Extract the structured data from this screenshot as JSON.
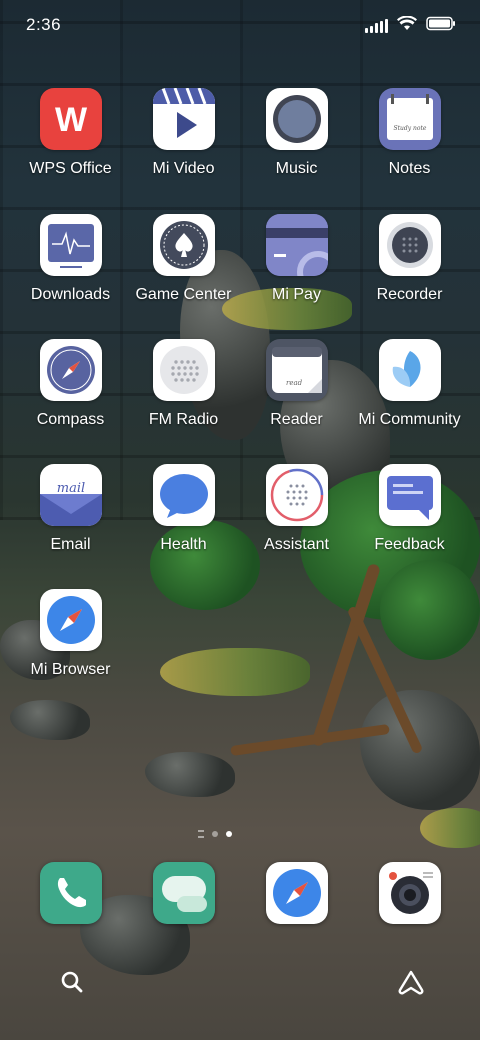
{
  "status_bar": {
    "time": "2:36",
    "icons": [
      "signal-icon",
      "wifi-icon",
      "battery-icon"
    ]
  },
  "apps": [
    {
      "label": "WPS Office",
      "icon": "wps-office-icon"
    },
    {
      "label": "Mi Video",
      "icon": "mi-video-icon"
    },
    {
      "label": "Music",
      "icon": "music-icon"
    },
    {
      "label": "Notes",
      "icon": "notes-icon"
    },
    {
      "label": "Downloads",
      "icon": "downloads-icon"
    },
    {
      "label": "Game Center",
      "icon": "game-center-icon"
    },
    {
      "label": "Mi Pay",
      "icon": "mi-pay-icon"
    },
    {
      "label": "Recorder",
      "icon": "recorder-icon"
    },
    {
      "label": "Compass",
      "icon": "compass-icon"
    },
    {
      "label": "FM Radio",
      "icon": "fm-radio-icon"
    },
    {
      "label": "Reader",
      "icon": "reader-icon"
    },
    {
      "label": "Mi Community",
      "icon": "mi-community-icon"
    },
    {
      "label": "Email",
      "icon": "email-icon"
    },
    {
      "label": "Health",
      "icon": "health-icon"
    },
    {
      "label": "Assistant",
      "icon": "assistant-icon"
    },
    {
      "label": "Feedback",
      "icon": "feedback-icon"
    },
    {
      "label": "Mi Browser",
      "icon": "mi-browser-icon"
    }
  ],
  "icon_text": {
    "wps": "W",
    "notes_note": "Study note",
    "email": "mail",
    "reader": "read"
  },
  "dock": [
    {
      "icon": "phone-icon"
    },
    {
      "icon": "messaging-icon"
    },
    {
      "icon": "browser-icon"
    },
    {
      "icon": "camera-icon"
    }
  ],
  "pager": {
    "current_page": 2,
    "total_pages": 2
  },
  "bottom": {
    "left_icon": "search-icon",
    "right_icon": "assistant-logo-icon"
  }
}
